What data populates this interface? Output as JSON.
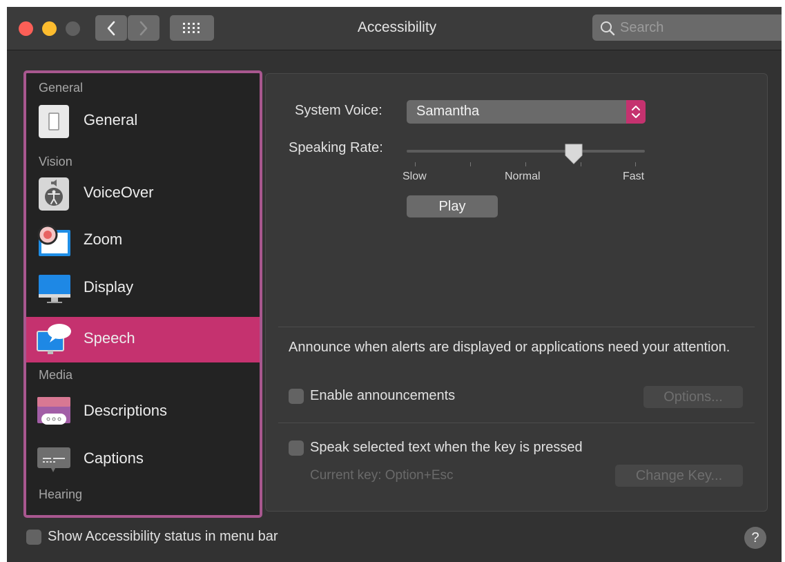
{
  "window": {
    "title": "Accessibility"
  },
  "search": {
    "placeholder": "Search",
    "icon": "magnifier"
  },
  "sidebar": {
    "sections": [
      "General",
      "Vision",
      "Media",
      "Hearing"
    ],
    "items": [
      {
        "label": "General",
        "icon": "switch-icon"
      },
      {
        "label": "VoiceOver",
        "icon": "voiceover-icon"
      },
      {
        "label": "Zoom",
        "icon": "zoom-icon"
      },
      {
        "label": "Display",
        "icon": "display-icon"
      },
      {
        "label": "Speech",
        "icon": "speech-icon",
        "selected": true
      },
      {
        "label": "Descriptions",
        "icon": "descriptions-icon"
      },
      {
        "label": "Captions",
        "icon": "captions-icon"
      }
    ]
  },
  "speech": {
    "system_voice_label": "System Voice:",
    "system_voice_value": "Samantha",
    "speaking_rate_label": "Speaking Rate:",
    "rate_slow": "Slow",
    "rate_normal": "Normal",
    "rate_fast": "Fast",
    "rate_position": 0.7,
    "play_label": "Play",
    "announce_text": "Announce when alerts are displayed or applications need your attention.",
    "enable_announcements": "Enable announcements",
    "options_label": "Options...",
    "speak_selected": "Speak selected text when the key is pressed",
    "current_key": "Current key: Option+Esc",
    "change_key_label": "Change Key..."
  },
  "footer": {
    "status_checkbox_label": "Show Accessibility status in menu bar",
    "help_label": "?"
  },
  "colors": {
    "accent": "#c5326f",
    "sidebar_border": "#a8578f",
    "window_bg": "#323232"
  }
}
